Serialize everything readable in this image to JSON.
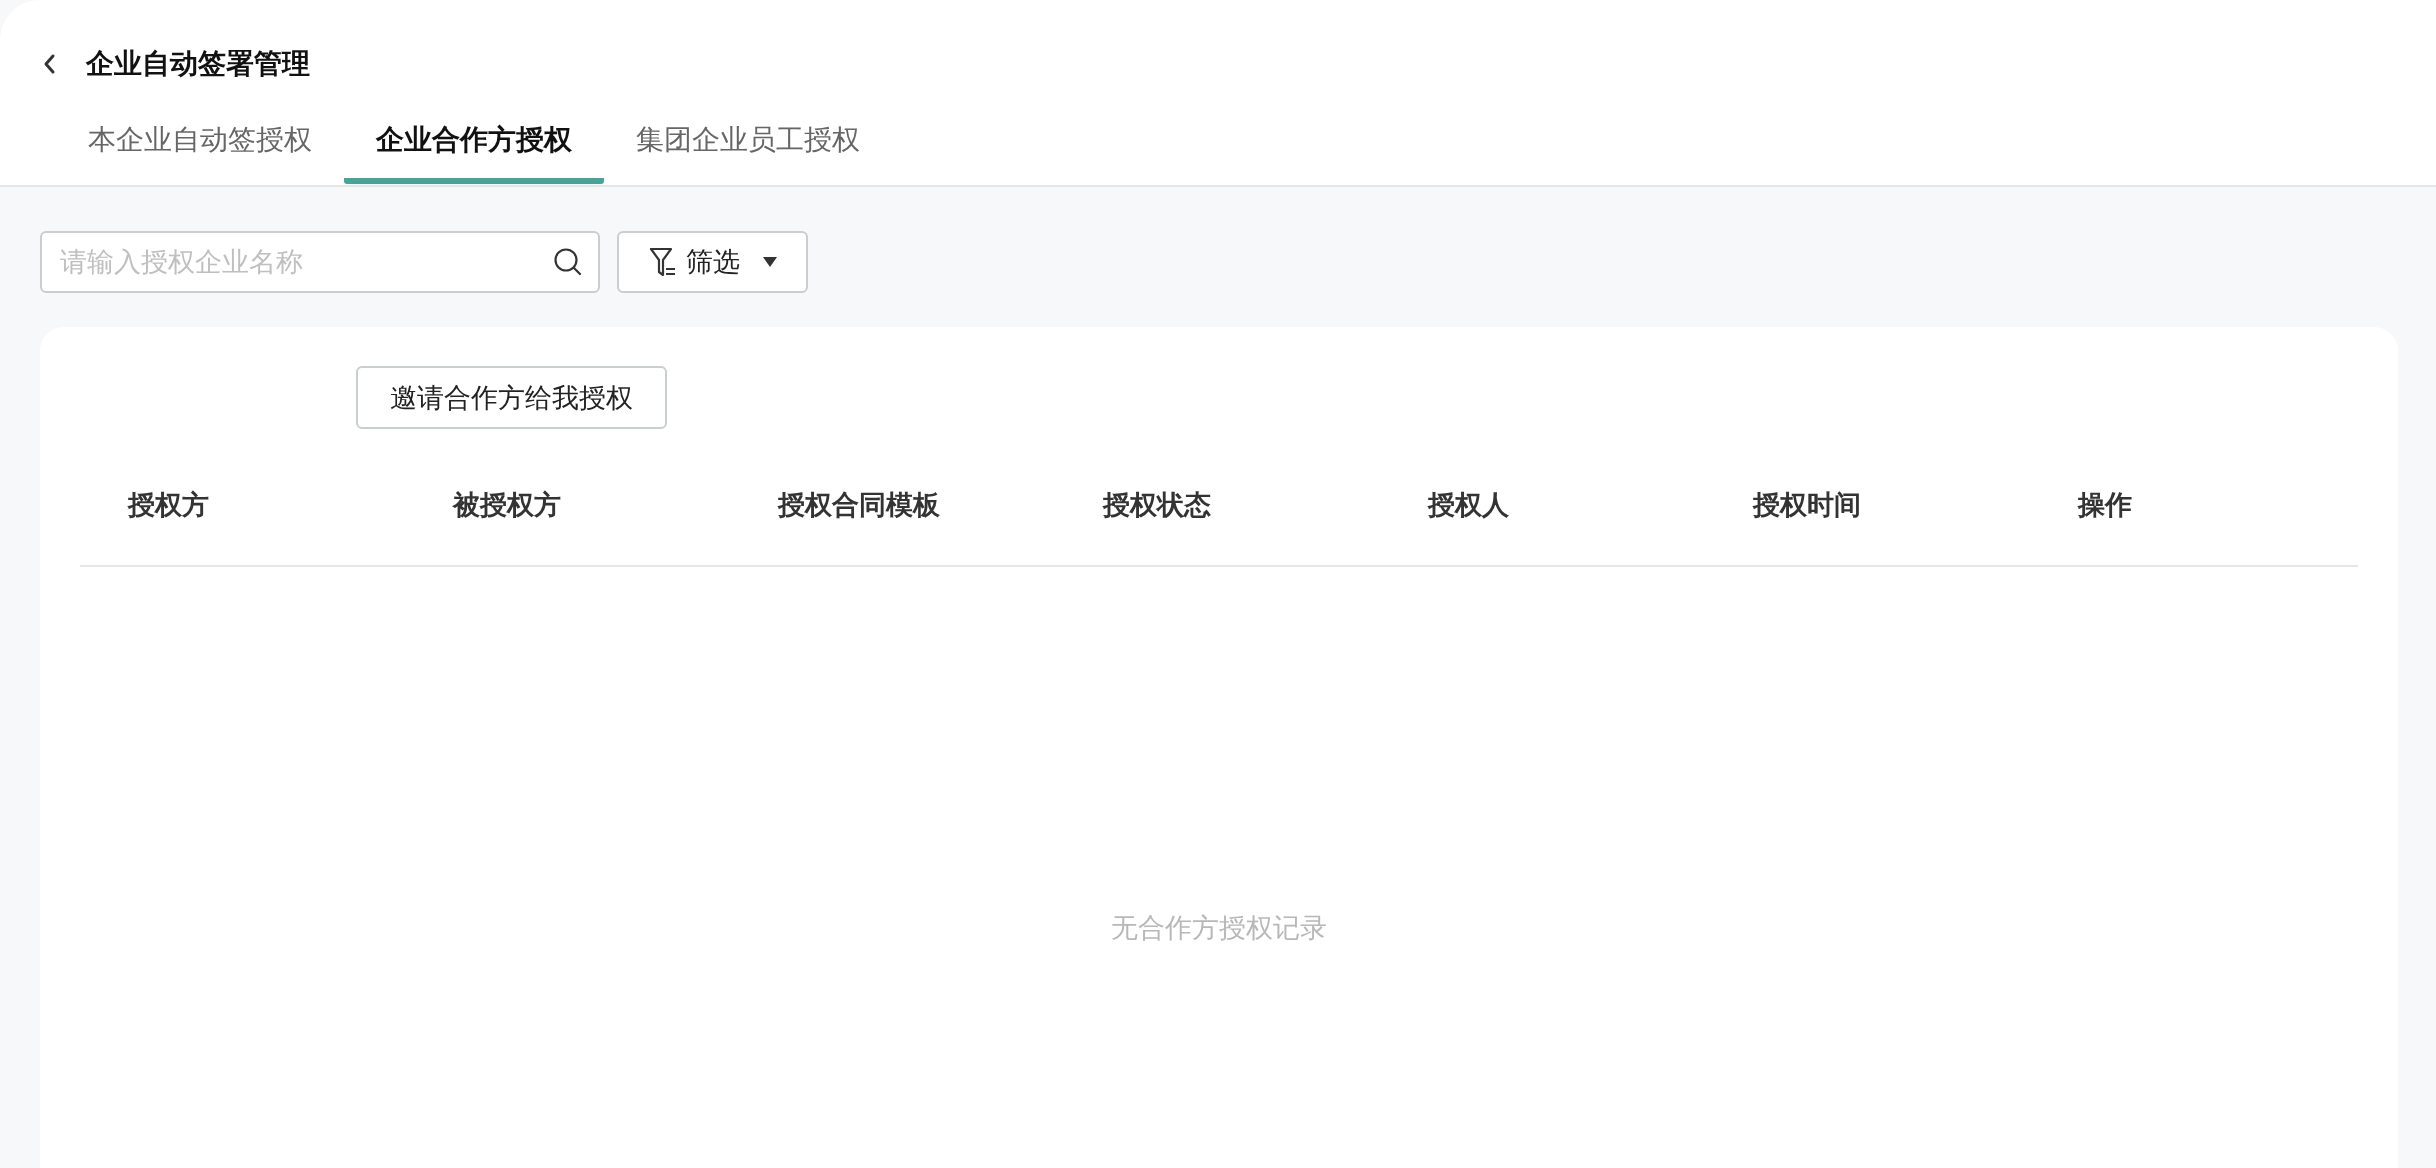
{
  "header": {
    "title": "企业自动签署管理"
  },
  "tabs": [
    {
      "label": "本企业自动签授权",
      "selected": false
    },
    {
      "label": "企业合作方授权",
      "selected": true
    },
    {
      "label": "集团企业员工授权",
      "selected": false
    }
  ],
  "search": {
    "placeholder": "请输入授权企业名称"
  },
  "filter": {
    "label": "筛选"
  },
  "invite_button": "邀请合作方给我授权",
  "table": {
    "columns": [
      "授权方",
      "被授权方",
      "授权合同模板",
      "授权状态",
      "授权人",
      "授权时间",
      "操作"
    ],
    "empty_text": "无合作方授权记录"
  }
}
